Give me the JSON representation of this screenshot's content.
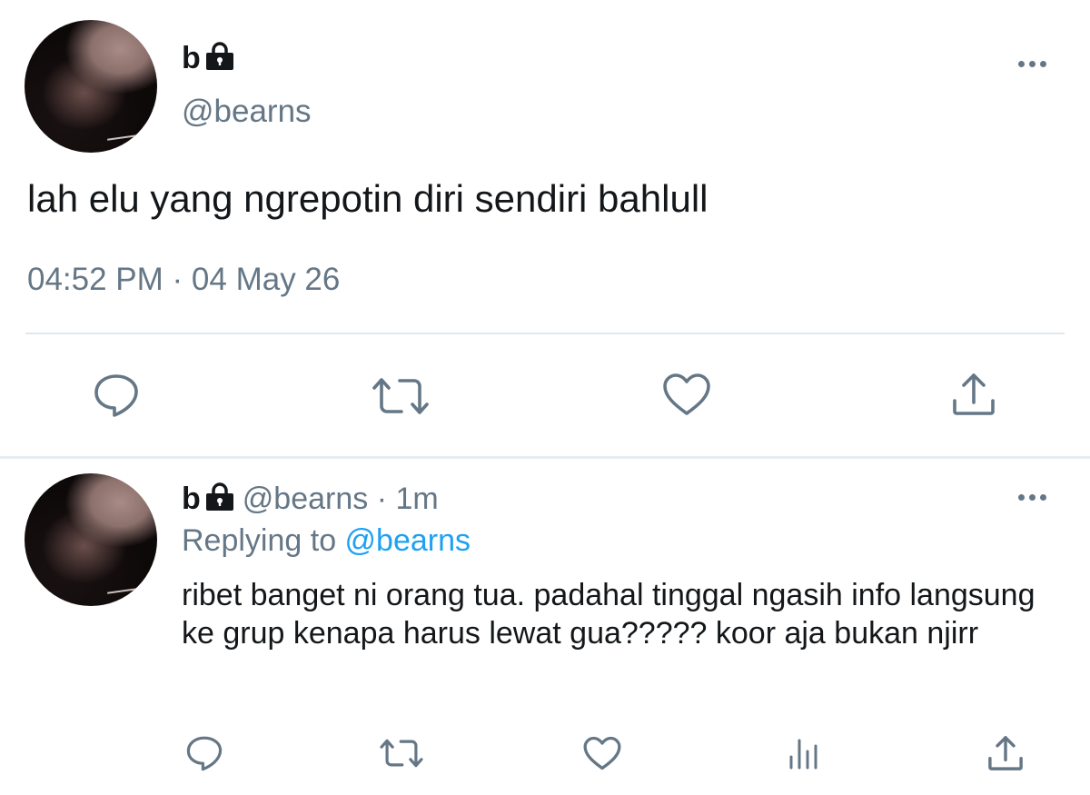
{
  "main_tweet": {
    "display_name": "b",
    "handle": "@bearns",
    "text": "lah elu yang ngrepotin diri sendiri bahlull",
    "timestamp": "04:52 PM · 04 May 26",
    "icons": [
      "lock-icon",
      "more-icon",
      "reply-icon",
      "retweet-icon",
      "like-icon",
      "share-icon"
    ]
  },
  "reply_tweet": {
    "display_name": "b",
    "handle": "@bearns",
    "separator": " · ",
    "time_ago": "1m",
    "replying_prefix": "Replying to ",
    "replying_to": "@bearns",
    "text": "ribet banget ni orang tua. padahal tinggal ngasih info langsung ke grup kenapa harus lewat gua????? koor aja bukan njirr",
    "icons": [
      "lock-icon",
      "more-icon",
      "reply-icon",
      "retweet-icon",
      "like-icon",
      "analytics-icon",
      "share-icon"
    ]
  },
  "colors": {
    "text_primary": "#14171a",
    "text_secondary": "#657786",
    "link": "#1da1f2",
    "divider": "#e1e8ed"
  }
}
